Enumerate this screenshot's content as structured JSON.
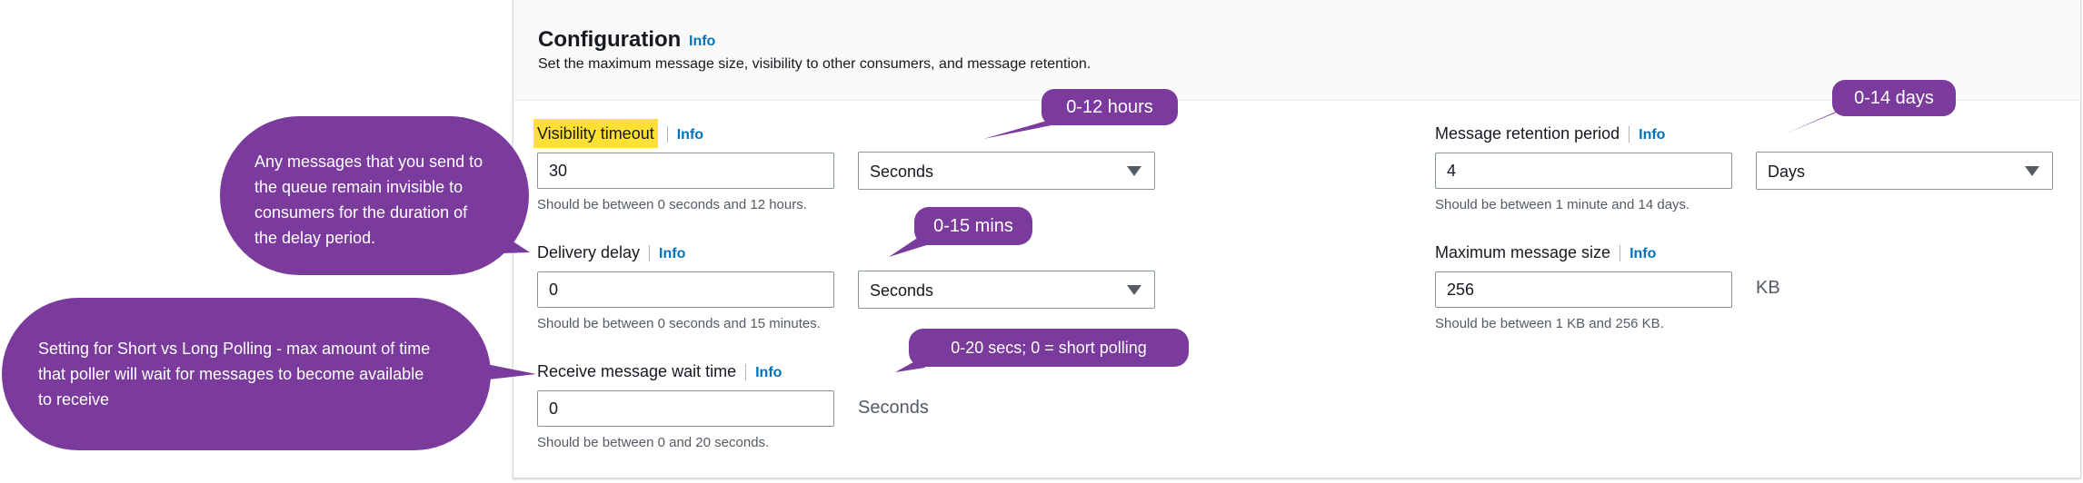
{
  "panel": {
    "title": "Configuration",
    "info": "Info",
    "description": "Set the maximum message size, visibility to other consumers, and message retention."
  },
  "fields": {
    "visibility_timeout": {
      "label": "Visibility timeout",
      "value": "30",
      "unit": "Seconds",
      "hint": "Should be between 0 seconds and 12 hours."
    },
    "delivery_delay": {
      "label": "Delivery delay",
      "value": "0",
      "unit": "Seconds",
      "hint": "Should be between 0 seconds and 15 minutes."
    },
    "receive_wait_time": {
      "label": "Receive message wait time",
      "value": "0",
      "unit": "Seconds",
      "hint": "Should be between 0 and 20 seconds."
    },
    "retention_period": {
      "label": "Message retention period",
      "value": "4",
      "unit": "Days",
      "hint": "Should be between 1 minute and 14 days."
    },
    "max_message_size": {
      "label": "Maximum message size",
      "value": "256",
      "unit": "KB",
      "hint": "Should be between 1 KB and 256 KB."
    }
  },
  "annotations": {
    "hours": "0-12 hours",
    "days": "0-14 days",
    "mins": "0-15 mins",
    "secs": "0-20 secs; 0 = short polling",
    "delay_note": "Any messages that you send to the queue remain invisible to consumers for the duration of the delay period.",
    "polling_note": "Setting for Short vs Long Polling - max amount of time that poller will wait for messages to become available to receive"
  },
  "colors": {
    "callout": "#7a3b9d",
    "highlight": "#ffe033",
    "info_link": "#0073bb"
  }
}
